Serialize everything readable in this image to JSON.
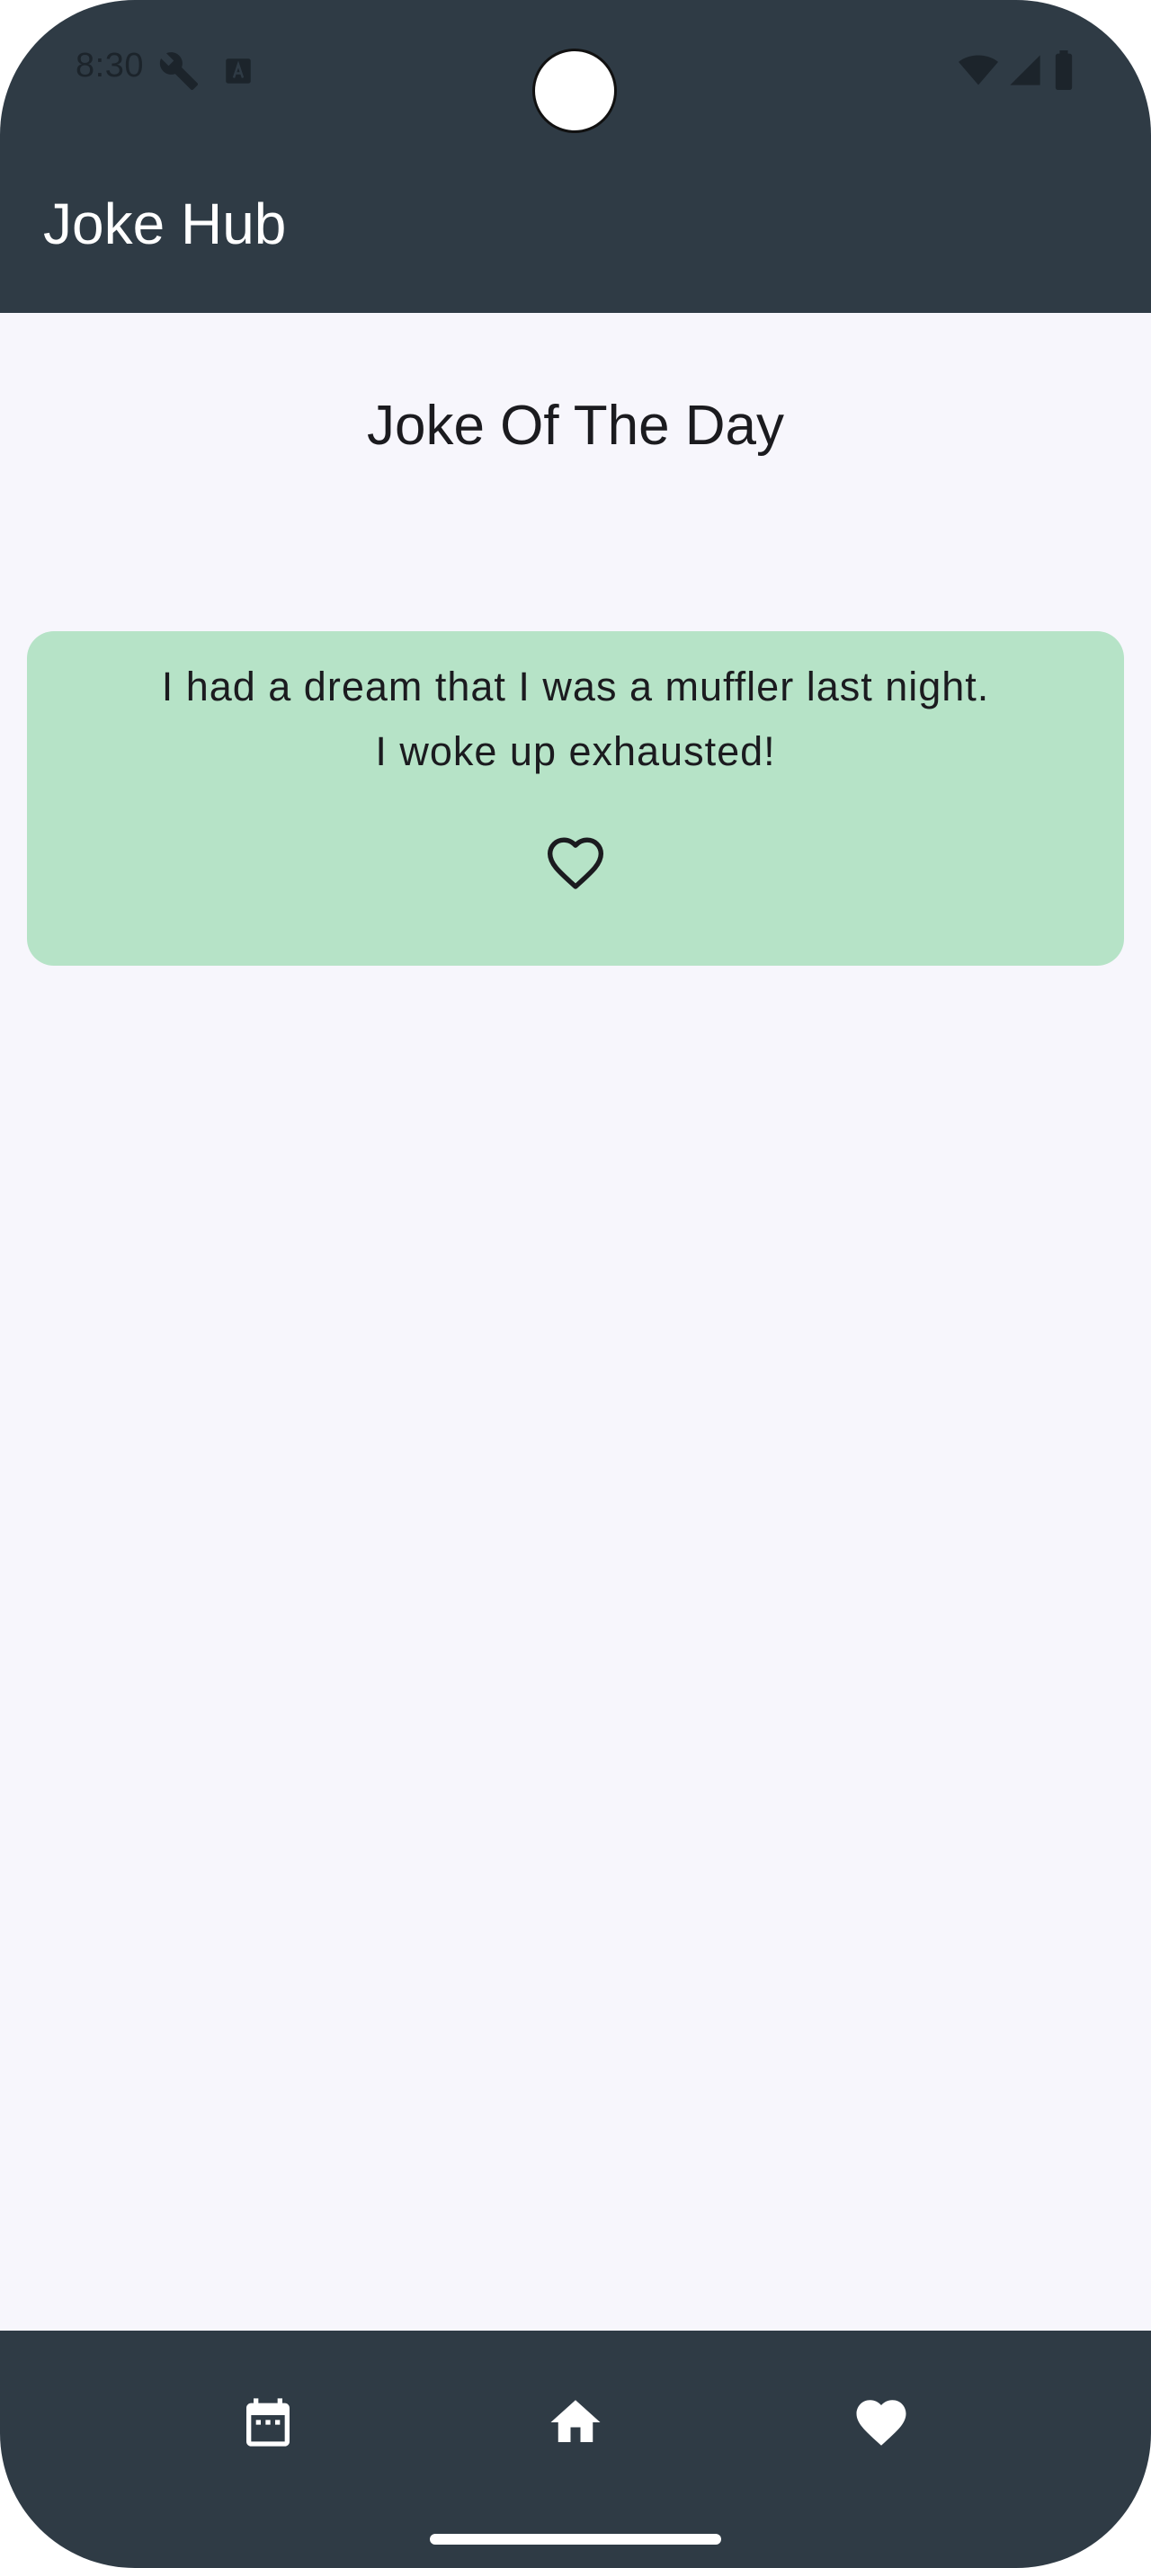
{
  "status_bar": {
    "time": "8:30",
    "icons": [
      "wrench-icon",
      "keyboard-a-icon",
      "wifi-icon",
      "signal-icon",
      "battery-icon"
    ]
  },
  "app_bar": {
    "title": "Joke Hub"
  },
  "main": {
    "section_title": "Joke Of The Day",
    "joke": {
      "line1": "I had a dream that I was a muffler last night.",
      "line2": "I woke up exhausted!",
      "favorite_icon": "heart-outline-icon",
      "favorited": false
    }
  },
  "bottom_nav": {
    "items": [
      {
        "icon": "calendar-icon"
      },
      {
        "icon": "home-icon"
      },
      {
        "icon": "heart-icon"
      }
    ]
  },
  "colors": {
    "bar_background": "#2F3B45",
    "page_background": "#F7F6FC",
    "card_background": "#B6E3C7"
  }
}
